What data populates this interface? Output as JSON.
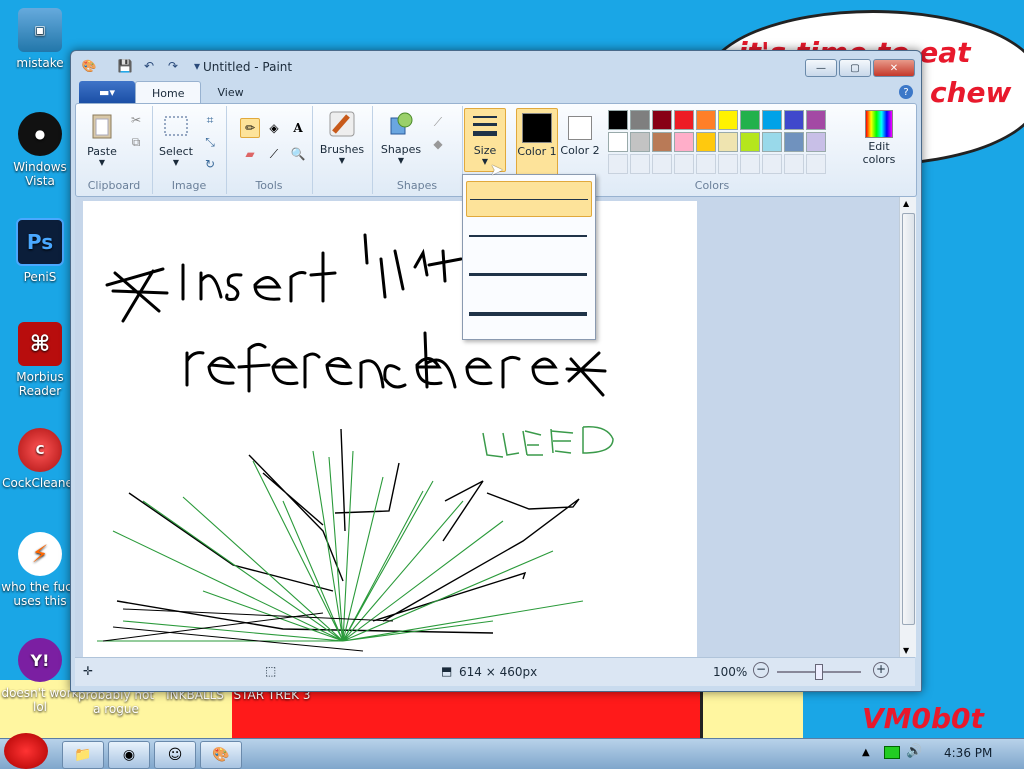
{
  "desktop": {
    "icons": [
      {
        "label": "mistake"
      },
      {
        "label": "Windows Vista"
      },
      {
        "label": "PeniS"
      },
      {
        "label": "Morbius Reader"
      },
      {
        "label": "CockCleaner"
      },
      {
        "label": "who the fuck uses this"
      },
      {
        "label": "doesn't work lol"
      },
      {
        "label": "probably not a rogue"
      },
      {
        "label": "INKBALLS"
      },
      {
        "label": "STAR TREK 3"
      }
    ],
    "wallpaper_text": {
      "line1": "it's time to eat shit",
      "line2": "chew",
      "signature": "VM0b0t"
    }
  },
  "window": {
    "title": "Untitled - Paint",
    "file_tab": "▾",
    "tabs": [
      "Home",
      "View"
    ],
    "groups": {
      "clipboard": {
        "label": "Clipboard",
        "paste": "Paste"
      },
      "image": {
        "label": "Image",
        "select": "Select"
      },
      "tools": {
        "label": "Tools"
      },
      "brushes": {
        "label": "Brushes"
      },
      "shapes": {
        "label": "Shapes",
        "shapes_btn": "Shapes"
      },
      "size": {
        "label": "Size"
      },
      "colors": {
        "label": "Colors",
        "color1": "Color 1",
        "color2": "Color 2",
        "edit": "Edit colors",
        "color1_value": "#000000",
        "color2_value": "#ffffff",
        "palette_row1": [
          "#000000",
          "#7f7f7f",
          "#880015",
          "#ed1c24",
          "#ff7f27",
          "#fff200",
          "#22b14c",
          "#00a2e8",
          "#3f48cc",
          "#a349a4"
        ],
        "palette_row2": [
          "#ffffff",
          "#c3c3c3",
          "#b97a57",
          "#ffaec9",
          "#ffc90e",
          "#efe4b0",
          "#b5e61d",
          "#99d9ea",
          "#7092be",
          "#c8bfe7"
        ]
      }
    },
    "status": {
      "dimensions": "614 × 460px",
      "zoom": "100%"
    }
  },
  "taskbar": {
    "clock": "4:36 PM"
  }
}
